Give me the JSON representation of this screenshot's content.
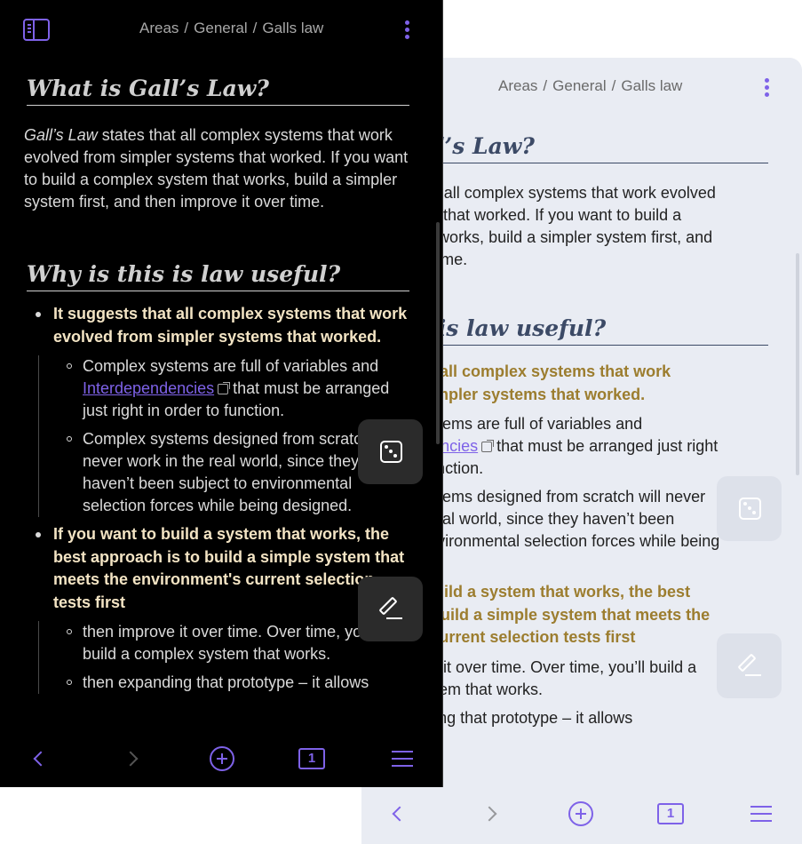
{
  "breadcrumbs": [
    "Areas",
    "General",
    "Galls law"
  ],
  "breadcrumb_separator": "/",
  "note": {
    "heading1": "What is Gall’s Law?",
    "intro_term": "Gall’s Law",
    "intro_rest": " states that all complex systems that work evolved from simpler systems that worked. If you want to build a complex system that works, build a simpler system first, and then improve it over time.",
    "heading2": "Why is this is law useful?",
    "bullet1": "It suggests that all complex systems that work evolved from simpler systems that worked.",
    "sub1a_pre": "Complex systems are full of variables and ",
    "sub1a_link": "Interdependencies",
    "sub1a_post": " that must be arranged just right in order to function.",
    "sub1b": "Complex systems designed from scratch will never work in the real world, since they haven’t been subject to environmental selection forces while being designed.",
    "bullet2": "If you want to build a system that works, the best approach is to build a simple system that meets the environment's current selection tests first",
    "sub2a": "then improve it over time. Over time, you’ll build a complex system that works.",
    "sub2b": "then expanding that prototype – it allows"
  },
  "nav": {
    "tab_count": "1",
    "icons": [
      "chevron-left-icon",
      "chevron-right-icon",
      "plus-circle-icon",
      "tabs-icon",
      "menu-icon"
    ]
  },
  "themes": {
    "dark": {
      "background": "#000000",
      "text": "#dadada",
      "bold": "#f3e4c4",
      "heading": "#d0d0d0",
      "breadcrumb": "#a8a8a8",
      "accent": "#7e62e8",
      "fab": "#2b2b2b",
      "fab_icon": "#ffffff"
    },
    "light": {
      "background": "#e9ecf3",
      "text": "#222222",
      "bold": "#9c7d2f",
      "heading": "#3c4a66",
      "breadcrumb": "#6a6a6a",
      "accent": "#7e62e8",
      "fab": "#dde1ea",
      "fab_icon": "#ffffff"
    }
  }
}
